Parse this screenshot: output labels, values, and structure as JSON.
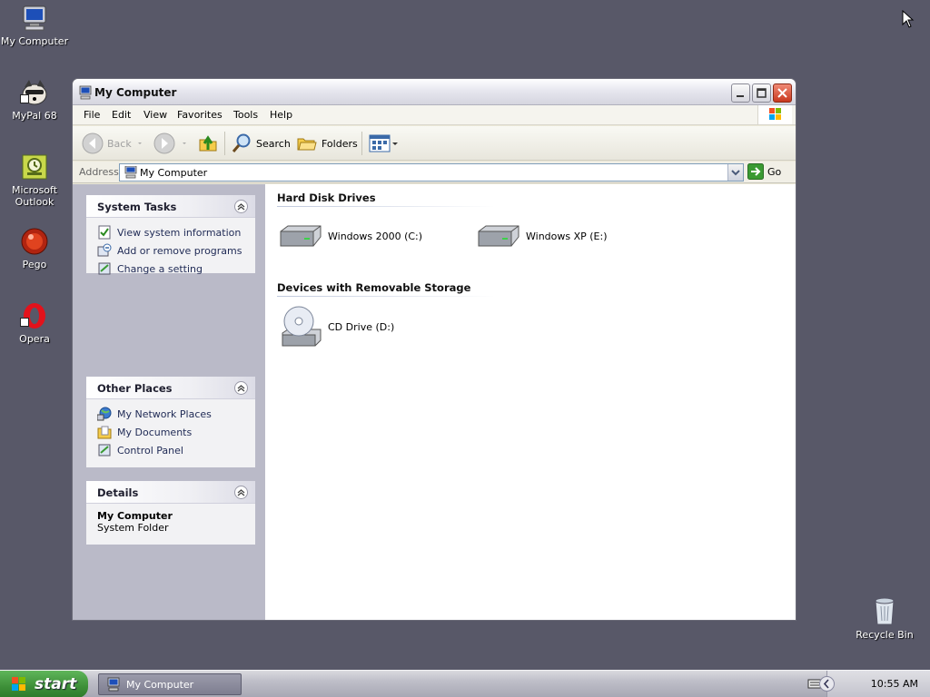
{
  "desktop": {
    "icons": [
      {
        "label": "My Computer",
        "icon": "my-computer-icon"
      },
      {
        "label": "MyPal 68",
        "icon": "mypal-icon"
      },
      {
        "label": "Microsoft\nOutlook",
        "icon": "outlook-icon"
      },
      {
        "label": "Pego",
        "icon": "pego-icon"
      },
      {
        "label": "Opera",
        "icon": "opera-icon"
      }
    ],
    "recycle_bin": "Recycle Bin"
  },
  "window": {
    "title": "My Computer",
    "menu": [
      "File",
      "Edit",
      "View",
      "Favorites",
      "Tools",
      "Help"
    ],
    "toolbar": {
      "back": "Back",
      "search": "Search",
      "folders": "Folders"
    },
    "address": {
      "label": "Address",
      "value": "My Computer",
      "go": "Go"
    }
  },
  "taskpane": {
    "system_tasks": {
      "title": "System Tasks",
      "items": [
        "View system information",
        "Add or remove programs",
        "Change a setting"
      ]
    },
    "other_places": {
      "title": "Other Places",
      "items": [
        "My Network Places",
        "My Documents",
        "Control Panel"
      ]
    },
    "details": {
      "title": "Details",
      "name": "My Computer",
      "type": "System Folder"
    }
  },
  "content": {
    "hard_disk_title": "Hard Disk Drives",
    "drives": [
      "Windows 2000 (C:)",
      "Windows XP (E:)"
    ],
    "removable_title": "Devices with Removable Storage",
    "removable": [
      "CD Drive (D:)"
    ]
  },
  "taskbar": {
    "start": "start",
    "task": "My Computer",
    "clock": "10:55 AM"
  },
  "colors": {
    "desktop": "#585868",
    "taskpane": "#babac8",
    "start_green": "#3d8f38"
  }
}
